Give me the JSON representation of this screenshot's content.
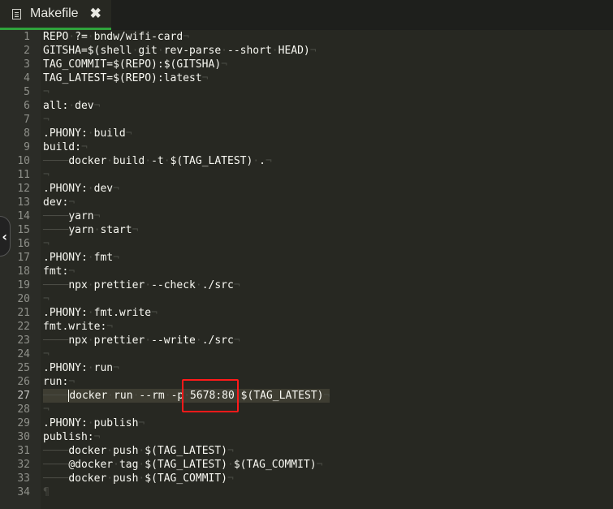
{
  "tab": {
    "icon": "file-text-icon",
    "title": "Makefile",
    "close_label": "✖"
  },
  "sidebar_toggle": {
    "icon": "chevron-left-icon",
    "label": "‹"
  },
  "editor": {
    "active_line": 27,
    "lines": [
      "REPO ?= bndw/wifi-card",
      "GITSHA=$(shell git rev-parse --short HEAD)",
      "TAG_COMMIT=$(REPO):$(GITSHA)",
      "TAG_LATEST=$(REPO):latest",
      "",
      "all: dev",
      "",
      ".PHONY: build",
      "build:",
      "\tdocker build -t $(TAG_LATEST) .",
      "",
      ".PHONY: dev",
      "dev:",
      "\tyarn",
      "\tyarn start",
      "",
      ".PHONY: fmt",
      "fmt:",
      "\tnpx prettier --check ./src",
      "",
      ".PHONY: fmt.write",
      "fmt.write:",
      "\tnpx prettier --write ./src",
      "",
      ".PHONY: run",
      "run:",
      "\tdocker run --rm -p 5678:80 $(TAG_LATEST)",
      "",
      ".PHONY: publish",
      "publish:",
      "\tdocker push $(TAG_LATEST)",
      "\t@docker tag $(TAG_LATEST) $(TAG_COMMIT)",
      "\tdocker push $(TAG_COMMIT)",
      ""
    ]
  },
  "annotation": {
    "color": "#ff1a1a"
  }
}
